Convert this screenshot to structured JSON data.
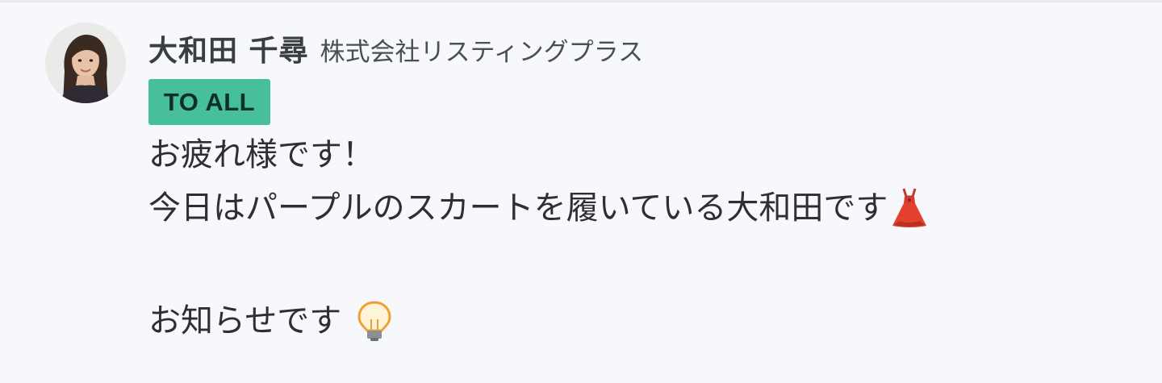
{
  "message": {
    "sender": {
      "name": "大和田 千尋",
      "organization": "株式会社リスティングプラス"
    },
    "recipient_badge": "TO ALL",
    "body": {
      "line1": "お疲れ様です！",
      "line2": "今日はパープルのスカートを履いている大和田です",
      "line2_icon": "dress-icon",
      "line3": "お知らせです",
      "line3_icon": "light-bulb-icon"
    }
  },
  "colors": {
    "background": "#f7f8fb",
    "badge_background": "#47bf9d",
    "badge_text": "#0f3026",
    "text": "#2d2f33"
  }
}
